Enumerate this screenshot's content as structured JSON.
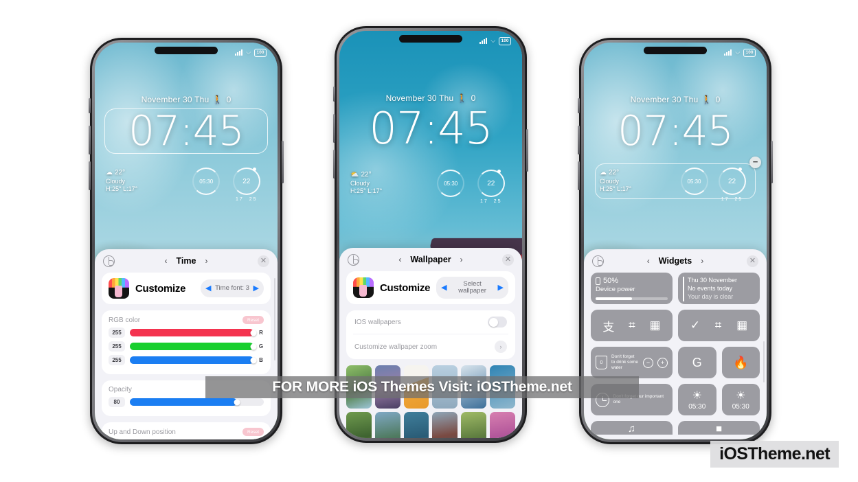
{
  "background_color": "#ffffff",
  "watermark": {
    "banner_text": "FOR MORE iOS Themes Visit: iOSTheme.net",
    "logo_text": "iOSTheme.net"
  },
  "status_bar": {
    "battery": "100"
  },
  "lock_screen": {
    "date": "November 30 Thu",
    "steps": "0",
    "time": "07:45",
    "weather": {
      "temperature": "22°",
      "condition": "Cloudy",
      "high_low": "H:25° L:17°"
    },
    "alarm_ring": "05:30",
    "temp_ring": {
      "value": "22",
      "low": "17",
      "high": "25"
    },
    "remove_button": "−"
  },
  "phones": [
    {
      "id": "phone-time",
      "panel": {
        "title": "Time",
        "prev": "‹",
        "next": "›",
        "close": "✕",
        "customize": {
          "label": "Customize",
          "stepper_value": "Time font: 3",
          "left": "◀",
          "right": "▶"
        },
        "rgb": {
          "title": "RGB color",
          "reset": "Reset",
          "channels": [
            {
              "value": "255",
              "letter": "R",
              "color": "#f4334f",
              "percent": 100
            },
            {
              "value": "255",
              "letter": "G",
              "color": "#18cf2e",
              "percent": 100
            },
            {
              "value": "255",
              "letter": "B",
              "color": "#1b7ef2",
              "percent": 100
            }
          ]
        },
        "opacity": {
          "title": "Opacity",
          "value": "80",
          "percent": 80,
          "color": "#1b7ef2"
        },
        "position": {
          "title": "Up and Down position",
          "reset": "Reset"
        }
      }
    },
    {
      "id": "phone-wallpaper",
      "panel": {
        "title": "Wallpaper",
        "prev": "‹",
        "next": "›",
        "close": "✕",
        "customize": {
          "label": "Customize",
          "stepper_value": "Select wallpaper",
          "left": "◀",
          "right": "▶"
        },
        "options": [
          {
            "label": "IOS wallpapers",
            "control": "toggle",
            "state": "off"
          },
          {
            "label": "Customize wallpaper zoom",
            "control": "chevron",
            "glyph": "›"
          }
        ],
        "wallpaper_thumbs": [
          "#6f9a5e",
          "#4a4a6e",
          "#e8a33d",
          "#8ea9c4",
          "#b9c7d6",
          "#2f7fa8",
          "#5f7d3a",
          "#6d8fa8",
          "#3f7c96",
          "#7a6a62",
          "#8ba35c",
          "#c4739c"
        ]
      }
    },
    {
      "id": "phone-widgets",
      "panel": {
        "title": "Widgets",
        "prev": "‹",
        "next": "›",
        "close": "✕",
        "widgets": {
          "device_power": {
            "percent": "50%",
            "label": "Device power",
            "fill": 50
          },
          "calendar": {
            "date": "Thu 30 November",
            "events": "No events today",
            "note": "Your day is clear"
          },
          "shortcut_alipay": {
            "glyph": "支",
            "scan": "⌗",
            "qr": "▦"
          },
          "shortcut_wechat": {
            "glyph": "✓",
            "scan": "⌗",
            "qr": "▦"
          },
          "water": {
            "count": "0",
            "note": "Don't forget to drink some water",
            "minus": "−",
            "plus": "+"
          },
          "google": {
            "glyph": "G"
          },
          "bonfire": {
            "glyph": "🔥"
          },
          "reminder": {
            "note": "Don't forget our important one"
          },
          "alarm_a": {
            "time": "05:30"
          },
          "alarm_b": {
            "time": "05:30"
          }
        }
      }
    }
  ]
}
